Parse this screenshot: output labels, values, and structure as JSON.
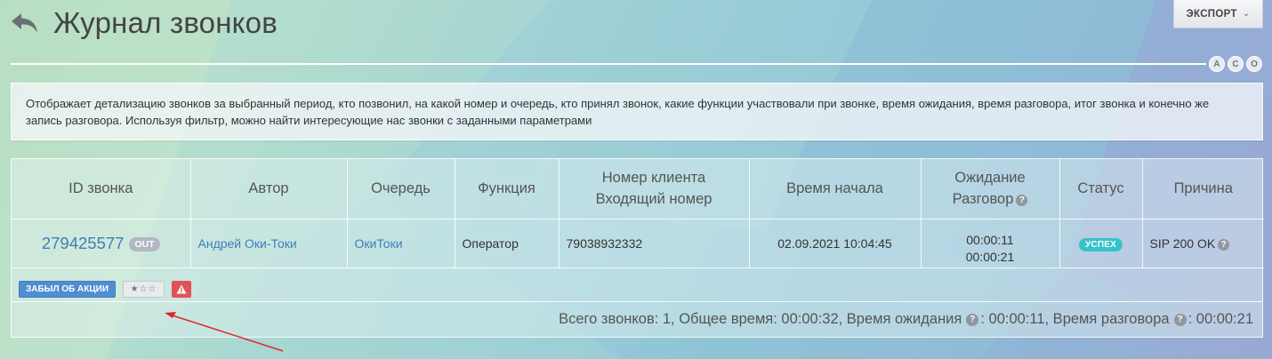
{
  "header": {
    "title": "Журнал звонков",
    "export_label": "ЭКСПОРТ",
    "view_toggles": [
      "A",
      "C",
      "O"
    ]
  },
  "info": {
    "text": "Отображает детализацию звонков за выбранный период, кто позвонил, на какой номер и очередь, кто принял звонок, какие функции участвовали при звонке, время ожидания, время разговора, итог звонка и конечно же запись разговора. Используя фильтр, можно найти интересующие нас звонки с заданными параметрами"
  },
  "table": {
    "columns": {
      "id": "ID звонка",
      "author": "Автор",
      "queue": "Очередь",
      "function": "Функция",
      "client_line1": "Номер клиента",
      "client_line2": "Входящий номер",
      "start": "Время начала",
      "wait_line1": "Ожидание",
      "wait_line2": "Разговор",
      "status": "Статус",
      "reason": "Причина"
    },
    "row": {
      "id": "279425577",
      "direction": "OUT",
      "author": "Андрей Оки-Токи",
      "queue": "ОкиТоки",
      "function": "Оператор",
      "client_number": "79038932332",
      "start": "02.09.2021 10:04:45",
      "wait": "00:00:11",
      "talk": "00:00:21",
      "status": "УСПЕХ",
      "reason": "SIP 200 OK"
    },
    "actions": {
      "tag_label": "ЗАБЫЛ ОБ АКЦИИ",
      "rating_stars": "★☆☆"
    },
    "summary": {
      "part1": "Всего звонков: 1, Общее время: 00:00:32, Время ожидания",
      "part2": ": 00:00:11, Время разговора",
      "part3": ": 00:00:21"
    }
  },
  "colors": {
    "link": "#3e7fb8",
    "status_success": "#35c2c9",
    "tag_blue": "#4f8ed0",
    "warn_red": "#e0525a",
    "annotation_arrow": "#e0272b"
  }
}
